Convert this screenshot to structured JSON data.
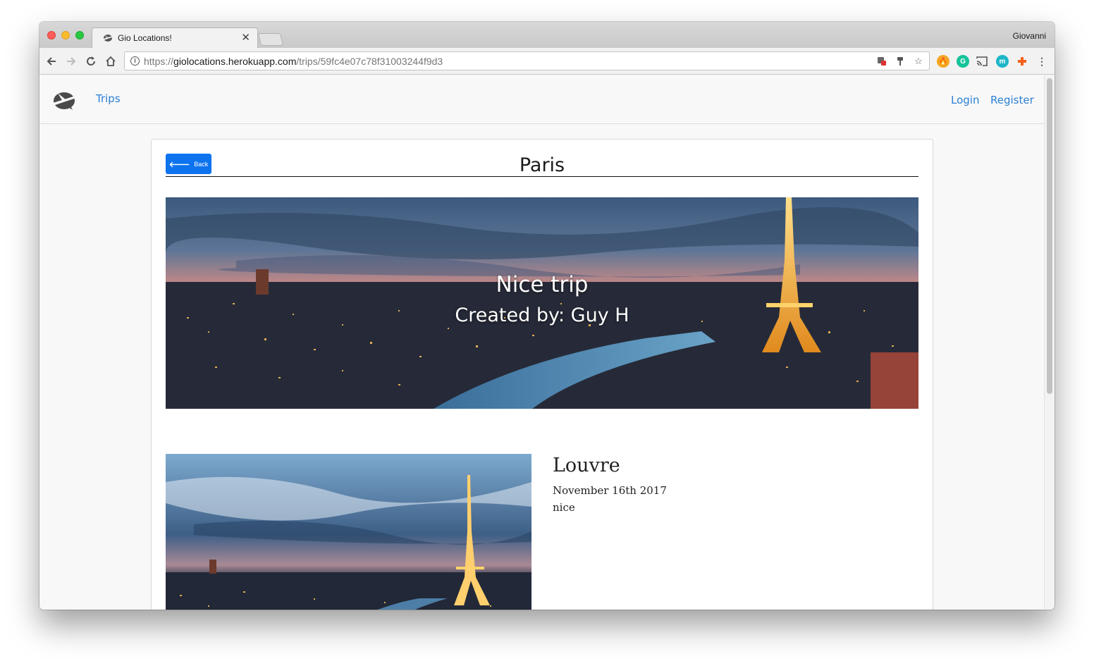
{
  "browser": {
    "tab_title": "Gio Locations!",
    "tab_close": "✕",
    "profile_name": "Giovanni",
    "url_prefix": "https://",
    "url_host": "giolocations.herokuapp.com",
    "url_path": "/trips/59fc4e07c78f31003244f9d3"
  },
  "navbar": {
    "trips_label": "Trips",
    "login_label": "Login",
    "register_label": "Register"
  },
  "trip": {
    "back_label": "Back",
    "back_arrow": "🡐",
    "title": "Paris",
    "hero_title": "Nice trip",
    "hero_subtitle": "Created by: Guy H"
  },
  "locations": [
    {
      "name": "Louvre",
      "date": "November 16th 2017",
      "description": "nice"
    }
  ],
  "colors": {
    "link": "#2a7fd4",
    "primary_button": "#0d73ee"
  }
}
